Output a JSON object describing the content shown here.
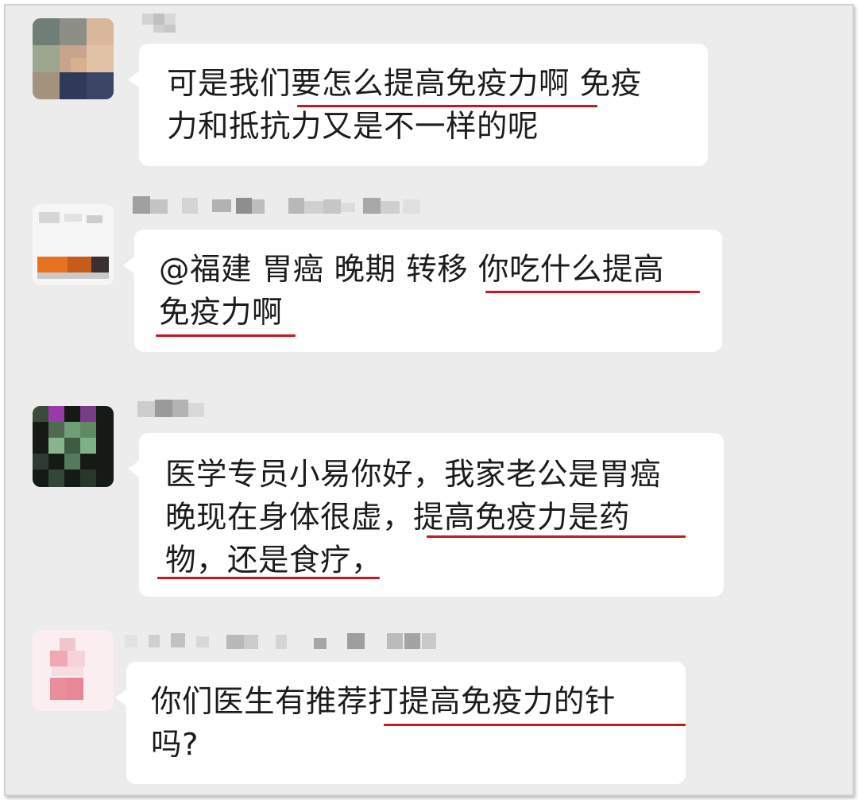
{
  "messages": [
    {
      "lines": [
        "可是我们要怎么提高免疫力啊  免疫",
        "力和抵抗力又是不一样的呢"
      ]
    },
    {
      "lines": [
        "@福建 胃癌 晚期 转移 你吃什么提高",
        "免疫力啊"
      ]
    },
    {
      "lines": [
        "医学专员小易你好，我家老公是胃癌",
        "晚现在身体很虚，提高免疫力是药",
        "物，还是食疗，"
      ]
    },
    {
      "lines": [
        "你们医生有推荐打提高免疫力的针",
        "吗?"
      ]
    }
  ],
  "colors": {
    "background": "#ececec",
    "bubble": "#ffffff",
    "text": "#1c1c1c",
    "underline": "#c8161e"
  }
}
